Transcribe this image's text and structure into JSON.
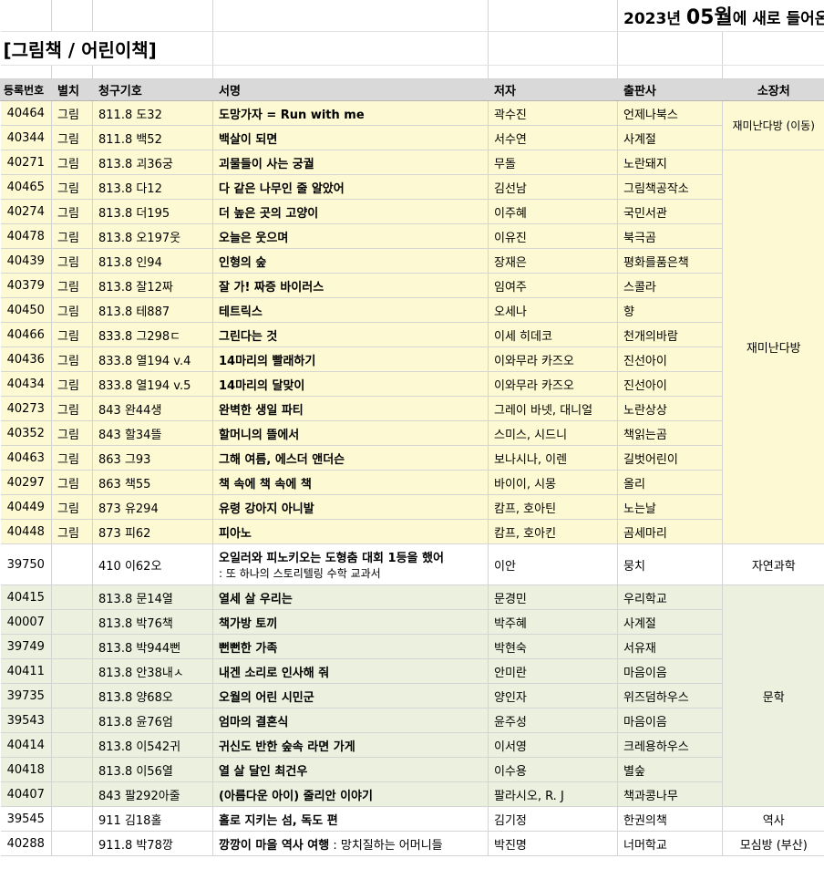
{
  "title": {
    "prefix": "2023년 ",
    "month": "05월",
    "suffix": "에 새로 들어온 책"
  },
  "section": "[그림책 / 어린이책]",
  "headers": [
    "등록번호",
    "별치",
    "청구기호",
    "서명",
    "저자",
    "출판사",
    "소장처"
  ],
  "rows": [
    {
      "no": "40464",
      "sep": "그림",
      "call": "811.8 도32",
      "title": "도망가자 = Run with me",
      "author": "곽수진",
      "pub": "언제나북스"
    },
    {
      "no": "40344",
      "sep": "그림",
      "call": "811.8 백52",
      "title": "백살이 되면",
      "author": "서수연",
      "pub": "사계절"
    },
    {
      "no": "40271",
      "sep": "그림",
      "call": "813.8 괴36궁",
      "title": "괴물들이 사는 궁궐",
      "author": "무돌",
      "pub": "노란돼지"
    },
    {
      "no": "40465",
      "sep": "그림",
      "call": "813.8 다12",
      "title": "다 같은 나무인 줄 알았어",
      "author": "김선남",
      "pub": "그림책공작소"
    },
    {
      "no": "40274",
      "sep": "그림",
      "call": "813.8 더195",
      "title": "더 높은 곳의 고양이",
      "author": "이주혜",
      "pub": "국민서관"
    },
    {
      "no": "40478",
      "sep": "그림",
      "call": "813.8 오197웃",
      "title": "오늘은 웃으며",
      "author": "이유진",
      "pub": "북극곰"
    },
    {
      "no": "40439",
      "sep": "그림",
      "call": "813.8 인94",
      "title": "인형의 숲",
      "author": "장재은",
      "pub": "평화를품은책"
    },
    {
      "no": "40379",
      "sep": "그림",
      "call": "813.8 잘12짜",
      "title": "잘 가! 짜증 바이러스",
      "author": "임여주",
      "pub": "스콜라"
    },
    {
      "no": "40450",
      "sep": "그림",
      "call": "813.8 테887",
      "title": "테트릭스",
      "author": "오세나",
      "pub": "향"
    },
    {
      "no": "40466",
      "sep": "그림",
      "call": "833.8 그298ㄷ",
      "title": "그린다는 것",
      "author": "이세 히데코",
      "pub": "천개의바람"
    },
    {
      "no": "40436",
      "sep": "그림",
      "call": "833.8 열194 v.4",
      "title": "14마리의 빨래하기",
      "author": "이와무라 카즈오",
      "pub": "진선아이"
    },
    {
      "no": "40434",
      "sep": "그림",
      "call": "833.8 열194 v.5",
      "title": "14마리의 달맞이",
      "author": "이와무라 카즈오",
      "pub": "진선아이"
    },
    {
      "no": "40273",
      "sep": "그림",
      "call": "843 완44생",
      "title": "완벽한 생일 파티",
      "author": "그레이 바넷, 대니얼",
      "pub": "노란상상"
    },
    {
      "no": "40352",
      "sep": "그림",
      "call": "843 할34뜰",
      "title": "할머니의 뜰에서",
      "author": "스미스, 시드니",
      "pub": "책읽는곰"
    },
    {
      "no": "40463",
      "sep": "그림",
      "call": "863 그93",
      "title": "그해 여름, 에스더 앤더슨",
      "author": "보나시나, 이렌",
      "pub": "길벗어린이"
    },
    {
      "no": "40297",
      "sep": "그림",
      "call": "863 책55",
      "title": "책 속에 책 속에 책",
      "author": "바이이, 시몽",
      "pub": "올리"
    },
    {
      "no": "40449",
      "sep": "그림",
      "call": "873 유294",
      "title": "유령 강아지 아니발",
      "author": "캄프, 호아틴",
      "pub": "노는날"
    },
    {
      "no": "40448",
      "sep": "그림",
      "call": "873 피62",
      "title": "피아노",
      "author": "캄프, 호아킨",
      "pub": "곰세마리"
    },
    {
      "no": "39750",
      "sep": "",
      "call": "410 이62오",
      "title": "오일러와 피노키오는 도형춤 대회 1등을 했어",
      "subtitle": ": 또 하나의 스토리텔링 수학 교과서",
      "author": "이안",
      "pub": "뭉치"
    },
    {
      "no": "40415",
      "sep": "",
      "call": "813.8 문14열",
      "title": "열세 살 우리는",
      "author": "문경민",
      "pub": "우리학교"
    },
    {
      "no": "40007",
      "sep": "",
      "call": "813.8 박76책",
      "title": "책가방 토끼",
      "author": "박주혜",
      "pub": "사계절"
    },
    {
      "no": "39749",
      "sep": "",
      "call": "813.8 박944뻔",
      "title": "뻔뻔한 가족",
      "author": "박현숙",
      "pub": "서유재"
    },
    {
      "no": "40411",
      "sep": "",
      "call": "813.8 안38내ㅅ",
      "title": "내겐 소리로 인사해 줘",
      "author": "안미란",
      "pub": "마음이음"
    },
    {
      "no": "39735",
      "sep": "",
      "call": "813.8 양68오",
      "title": "오월의 어린 시민군",
      "author": "양인자",
      "pub": "위즈덤하우스"
    },
    {
      "no": "39543",
      "sep": "",
      "call": "813.8 윤76엄",
      "title": "엄마의 결혼식",
      "author": "윤주성",
      "pub": "마음이음"
    },
    {
      "no": "40414",
      "sep": "",
      "call": "813.8 이542귀",
      "title": "귀신도 반한 숲속 라면 가게",
      "author": "이서영",
      "pub": "크레용하우스"
    },
    {
      "no": "40418",
      "sep": "",
      "call": "813.8 이56열",
      "title": "열 살 달인 최건우",
      "author": "이수용",
      "pub": "별숲"
    },
    {
      "no": "40407",
      "sep": "",
      "call": "843 팔292아줄",
      "title": "(아름다운 아이) 줄리안 이야기",
      "author": "팔라시오, R. J",
      "pub": "책과콩나무"
    },
    {
      "no": "39545",
      "sep": "",
      "call": "911 김18홀",
      "title": "홀로 지키는 섬, 독도 편",
      "author": "김기정",
      "pub": "한권의책"
    },
    {
      "no": "40288",
      "sep": "",
      "call": "911.8 박78깡",
      "title": "깡깡이 마을 역사 여행",
      "title_suffix": " : 망치질하는 어머니들",
      "author": "박진명",
      "pub": "너머학교"
    }
  ],
  "locations": {
    "loc1": "재미난다방 (이동)",
    "loc2": "재미난다방",
    "loc3": "자연과학",
    "loc4": "문학",
    "loc5": "역사",
    "loc6": "모심방 (부산)"
  },
  "colors": {
    "yellow_band": "#fdf9d3",
    "green_band": "#ebf1de",
    "header_bg": "#d9d9d9"
  }
}
